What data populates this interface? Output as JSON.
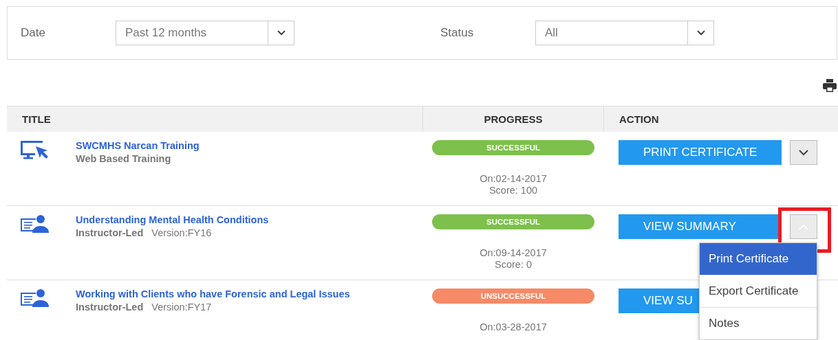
{
  "filters": [
    {
      "label": "Date",
      "value": "Past 12 months"
    },
    {
      "label": "Status",
      "value": "All"
    }
  ],
  "table": {
    "columns": [
      "TITLE",
      "PROGRESS",
      "ACTION"
    ],
    "rows": [
      {
        "kind": "web",
        "title": "SWCMHS Narcan Training",
        "type": "Web Based Training",
        "status": {
          "label": "SUCCESSFUL",
          "color": "#7dc04b"
        },
        "date": "On:02-14-2017",
        "score": "Score: 100",
        "action": "PRINT CERTIFICATE",
        "expanded": false,
        "highlighted": false
      },
      {
        "kind": "instructor",
        "title": "Understanding Mental Health Conditions",
        "type": "Instructor-Led",
        "version": "Version:FY16",
        "status": {
          "label": "SUCCESSFUL",
          "color": "#7dc04b"
        },
        "date": "On:09-14-2017",
        "score": "Score: 0",
        "action": "VIEW SUMMARY",
        "expanded": true,
        "highlighted": true,
        "menu": [
          {
            "label": "Print Certificate",
            "selected": true
          },
          {
            "label": "Export Certificate",
            "selected": false
          },
          {
            "label": "Notes",
            "selected": false
          }
        ]
      },
      {
        "kind": "instructor",
        "title": "Working with Clients who have Forensic and Legal Issues",
        "type": "Instructor-Led",
        "version": "Version:FY17",
        "status": {
          "label": "UNSUCCESSFUL",
          "color": "#f68a66"
        },
        "date": "On:03-28-2017",
        "action": "VIEW SU"
      }
    ]
  }
}
